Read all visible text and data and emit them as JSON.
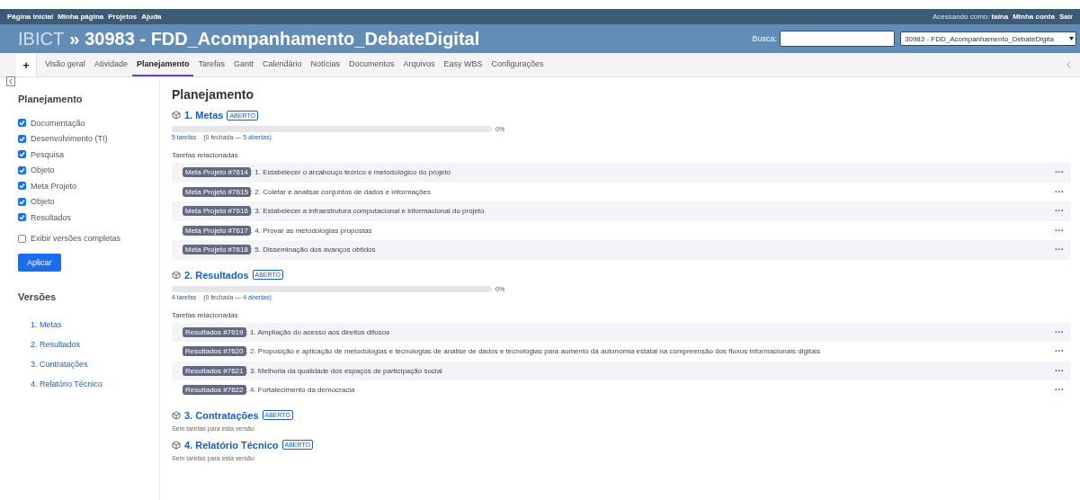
{
  "top_menu": {
    "links": [
      "Página inicial",
      "Minha página",
      "Projetos",
      "Ajuda"
    ],
    "logged_as_label": "Acessando como:",
    "user": "taina",
    "account_links": [
      "Minha conta",
      "Sair"
    ]
  },
  "header": {
    "parent": "IBICT",
    "separator": "»",
    "title": "30983 - FDD_Acompanhamento_DebateDigital",
    "search_label": "Busca:",
    "project_jump": "30983 - FDD_Acompanhamento_DebateDigita"
  },
  "tabs": [
    {
      "label": "+",
      "kind": "new",
      "selected": false
    },
    {
      "label": "Visão geral",
      "kind": "tab",
      "selected": false
    },
    {
      "label": "Atividade",
      "kind": "tab",
      "selected": false
    },
    {
      "label": "Planejamento",
      "kind": "tab",
      "selected": true
    },
    {
      "label": "Tarefas",
      "kind": "tab",
      "selected": false
    },
    {
      "label": "Gantt",
      "kind": "tab",
      "selected": false
    },
    {
      "label": "Calendário",
      "kind": "tab",
      "selected": false
    },
    {
      "label": "Notícias",
      "kind": "tab",
      "selected": false
    },
    {
      "label": "Documentos",
      "kind": "tab",
      "selected": false
    },
    {
      "label": "Arquivos",
      "kind": "tab",
      "selected": false
    },
    {
      "label": "Easy WBS",
      "kind": "tab",
      "selected": false
    },
    {
      "label": "Configurações",
      "kind": "tab",
      "selected": false
    }
  ],
  "sidebar": {
    "title": "Planejamento",
    "trackers": [
      {
        "label": "Documentação",
        "checked": true
      },
      {
        "label": "Desenvolvimento (TI)",
        "checked": true
      },
      {
        "label": "Pesquisa",
        "checked": true
      },
      {
        "label": "Objeto",
        "checked": true
      },
      {
        "label": "Meta Projeto",
        "checked": true
      },
      {
        "label": "Objeto",
        "checked": true
      },
      {
        "label": "Resultados",
        "checked": true
      }
    ],
    "completed_option": {
      "label": "Exibir versões completas",
      "checked": false
    },
    "apply_button": "Aplicar",
    "versions_title": "Versões",
    "versions": [
      "1. Metas",
      "2. Resultados",
      "3. Contratações",
      "4. Relatório Técnico"
    ]
  },
  "main": {
    "title": "Planejamento",
    "versions": [
      {
        "name": "1. Metas",
        "status": "ABERTO",
        "progress": {
          "level": 0,
          "percent": "0%",
          "total": "5 tarefas",
          "closed": "(0 fechada —",
          "open": "5 abertas",
          "close_paren": ")"
        },
        "related_title": "Tarefas relacionadas",
        "issues": [
          {
            "tracker": "Meta Projeto #7614",
            "subject": ": 1. Estabelecer o arcabouço teórico e metodológico do projeto",
            "menu": "···"
          },
          {
            "tracker": "Meta Projeto #7615",
            "subject": ": 2. Coletar e analisar conjuntos de dados e informações",
            "menu": "···"
          },
          {
            "tracker": "Meta Projeto #7616",
            "subject": ": 3. Estabelecer a infraestrutura computacional e informacional do projeto",
            "menu": "···"
          },
          {
            "tracker": "Meta Projeto #7617",
            "subject": ": 4. Provar as metodologias propostas",
            "menu": "···"
          },
          {
            "tracker": "Meta Projeto #7618",
            "subject": ": 5. Disseminação dos avanços obtidos",
            "menu": "···"
          }
        ]
      },
      {
        "name": "2. Resultados",
        "status": "ABERTO",
        "progress": {
          "level": 0,
          "percent": "0%",
          "total": "4 tarefas",
          "closed": "(0 fechada —",
          "open": "4 abertas",
          "close_paren": ")"
        },
        "related_title": "Tarefas relacionadas",
        "issues": [
          {
            "tracker": "Resultados #7619",
            "subject": ": 1. Ampliação do acesso aos direitos difusos",
            "menu": "···"
          },
          {
            "tracker": "Resultados #7620",
            "subject": ": 2. Proposição e aplicação de metodologias e tecnologias de análise de dados e tecnologias para aumento da autonomia estatal na compreensão dos fluxos informacionais digitais",
            "menu": "···"
          },
          {
            "tracker": "Resultados #7621",
            "subject": ": 3. Melhoria da qualidade dos espaços de participação social",
            "menu": "···"
          },
          {
            "tracker": "Resultados #7622",
            "subject": ": 4. Fortalecimento da democracia",
            "menu": "···"
          }
        ]
      },
      {
        "name": "3. Contratações",
        "status": "ABERTO",
        "empty_note": "Sem tarefas para esta versão"
      },
      {
        "name": "4. Relatório Técnico",
        "status": "ABERTO",
        "empty_note": "Sem tarefas para esta versão"
      }
    ]
  }
}
